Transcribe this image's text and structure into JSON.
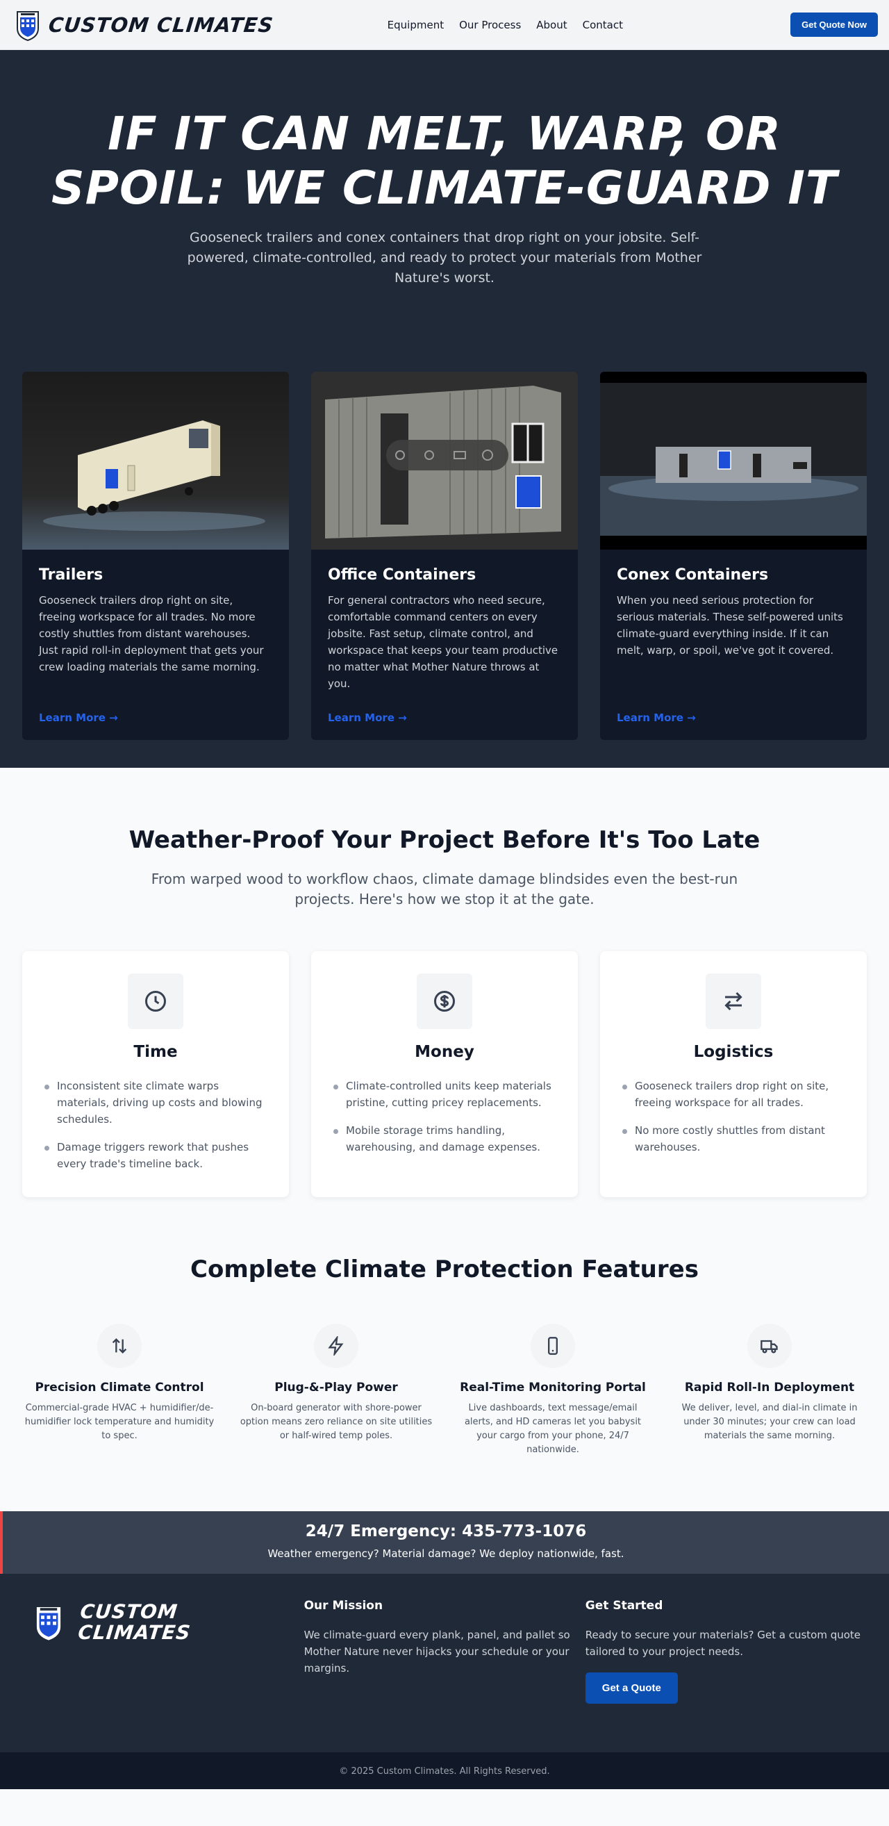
{
  "nav": {
    "brand": "CUSTOM CLIMATES",
    "links": [
      "Equipment",
      "Our Process",
      "About",
      "Contact"
    ],
    "cta": "Get Quote Now"
  },
  "hero": {
    "title": "IF IT CAN MELT, WARP, OR SPOIL: WE CLIMATE-GUARD IT",
    "subtitle": "Gooseneck trailers and conex containers that drop right on your jobsite. Self-powered, climate-controlled, and ready to protect your materials from Mother Nature's worst."
  },
  "products": [
    {
      "title": "Trailers",
      "body": "Gooseneck trailers drop right on site, freeing workspace for all trades. No more costly shuttles from distant warehouses. Just rapid roll-in deployment that gets your crew loading materials the same morning.",
      "link": "Learn More →"
    },
    {
      "title": "Office Containers",
      "body": "For general contractors who need secure, comfortable command centers on every jobsite. Fast setup, climate control, and workspace that keeps your team productive no matter what Mother Nature throws at you.",
      "link": "Learn More →"
    },
    {
      "title": "Conex Containers",
      "body": "When you need serious protection for serious materials. These self-powered units climate-guard everything inside. If it can melt, warp, or spoil, we've got it covered.",
      "link": "Learn More →"
    }
  ],
  "weather": {
    "title": "Weather-Proof Your Project Before It's Too Late",
    "subtitle": "From warped wood to workflow chaos, climate damage blindsides even the best-run projects. Here's how we stop it at the gate.",
    "cards": [
      {
        "title": "Time",
        "icon": "clock-icon",
        "points": [
          "Inconsistent site climate warps materials, driving up costs and blowing schedules.",
          "Damage triggers rework that pushes every trade's timeline back."
        ]
      },
      {
        "title": "Money",
        "icon": "dollar-icon",
        "points": [
          "Climate-controlled units keep materials pristine, cutting pricey replacements.",
          "Mobile storage trims handling, warehousing, and damage expenses."
        ]
      },
      {
        "title": "Logistics",
        "icon": "arrows-swap-icon",
        "points": [
          "Gooseneck trailers drop right on site, freeing workspace for all trades.",
          "No more costly shuttles from distant warehouses."
        ]
      }
    ]
  },
  "features": {
    "title": "Complete Climate Protection Features",
    "items": [
      {
        "title": "Precision Climate Control",
        "icon": "arrows-updown-icon",
        "body": "Commercial-grade HVAC + humidifier/de-humidifier lock temperature and humidity to spec."
      },
      {
        "title": "Plug-&-Play Power",
        "icon": "lightning-icon",
        "body": "On-board generator with shore-power option means zero reliance on site utilities or half-wired temp poles."
      },
      {
        "title": "Real-Time Monitoring Portal",
        "icon": "phone-icon",
        "body": "Live dashboards, text message/email alerts, and HD cameras let you babysit your cargo from your phone, 24/7 nationwide."
      },
      {
        "title": "Rapid Roll-In Deployment",
        "icon": "truck-icon",
        "body": "We deliver, level, and dial-in climate in under 30 minutes; your crew can load materials the same morning."
      }
    ]
  },
  "emergency": {
    "title": "24/7 Emergency: 435-773-1076",
    "subtitle": "Weather emergency? Material damage? We deploy nationwide, fast."
  },
  "footer": {
    "brand_line1": "CUSTOM",
    "brand_line2": "CLIMATES",
    "mission_title": "Our Mission",
    "mission_body": "We climate-guard every plank, panel, and pallet so Mother Nature never hijacks your schedule or your margins.",
    "start_title": "Get Started",
    "start_body": "Ready to secure your materials? Get a custom quote tailored to your project needs.",
    "start_cta": "Get a Quote",
    "copyright": "© 2025 Custom Climates. All Rights Reserved."
  },
  "colors": {
    "accent": "#0b4fb3",
    "dark": "#1f2937",
    "darker": "#111827",
    "emergency_border": "#ef4444"
  }
}
